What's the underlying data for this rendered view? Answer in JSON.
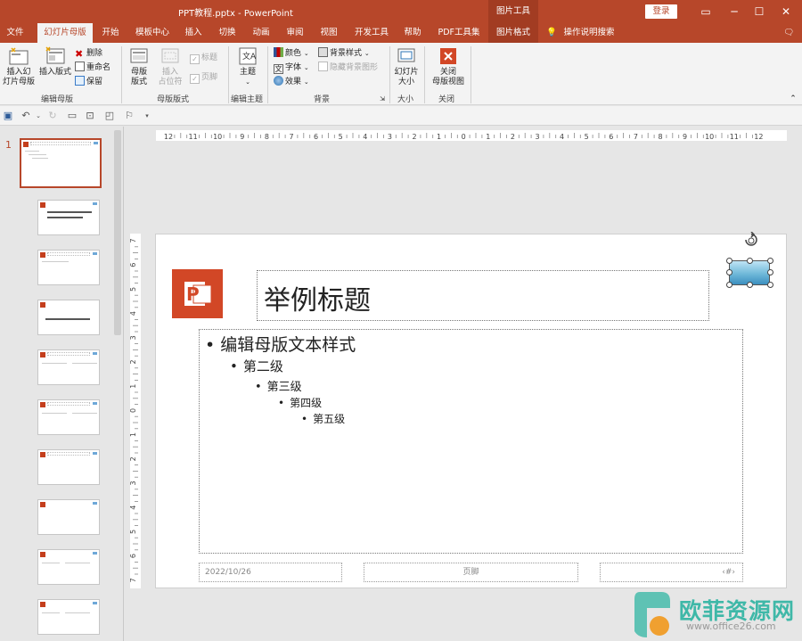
{
  "window": {
    "title": "PPT教程.pptx - PowerPoint",
    "context_label": "图片工具",
    "login_label": "登录",
    "minimize": "─",
    "restore": "☐",
    "close": "✕"
  },
  "tabs": [
    "文件",
    "幻灯片母版",
    "开始",
    "模板中心",
    "插入",
    "切换",
    "动画",
    "审阅",
    "视图",
    "开发工具",
    "帮助",
    "PDF工具集",
    "图片格式"
  ],
  "search_label": "操作说明搜索",
  "ribbon": {
    "edit_master": {
      "insert_master": "插入幻\n灯片母版",
      "insert_layout": "插入版式",
      "delete": "删除",
      "rename": "重命名",
      "preserve": "保留",
      "group_label": "编辑母版"
    },
    "master_layout": {
      "master_layout_btn": "母版\n版式",
      "insert_placeholder": "插入\n占位符",
      "title_check": "标题",
      "footer_check": "页脚",
      "group_label": "母版版式"
    },
    "edit_theme": {
      "themes": "主题",
      "group_label": "编辑主题"
    },
    "background": {
      "colors": "颜色",
      "fonts": "字体",
      "effects": "效果",
      "bg_styles": "背景样式",
      "hide_bg": "隐藏背景图形",
      "group_label": "背景"
    },
    "size": {
      "slide_size": "幻灯片\n大小",
      "group_label": "大小"
    },
    "close": {
      "close_master": "关闭\n母版视图",
      "group_label": "关闭"
    }
  },
  "slide_panel": {
    "selected_number": "1"
  },
  "hruler_ticks": [
    "12",
    "11",
    "10",
    "9",
    "8",
    "7",
    "6",
    "5",
    "4",
    "3",
    "2",
    "1",
    "0",
    "1",
    "2",
    "3",
    "4",
    "5",
    "6",
    "7",
    "8",
    "9",
    "10",
    "11",
    "12"
  ],
  "vruler_ticks": [
    "7",
    "6",
    "5",
    "4",
    "3",
    "2",
    "1",
    "0",
    "1",
    "2",
    "3",
    "4",
    "5",
    "6",
    "7"
  ],
  "slide": {
    "title": "举例标题",
    "level1": "编辑母版文本样式",
    "level2": "第二级",
    "level3": "第三级",
    "level4": "第四级",
    "level5": "第五级",
    "date": "2022/10/26",
    "footer": "页脚",
    "page_number": "‹#›"
  },
  "watermark": {
    "name": "欧菲资源网",
    "url": "www.office26.com"
  },
  "colors": {
    "accent": "#b7472a",
    "logo_red": "#d24726",
    "watermark_teal": "#3fb8a8"
  }
}
